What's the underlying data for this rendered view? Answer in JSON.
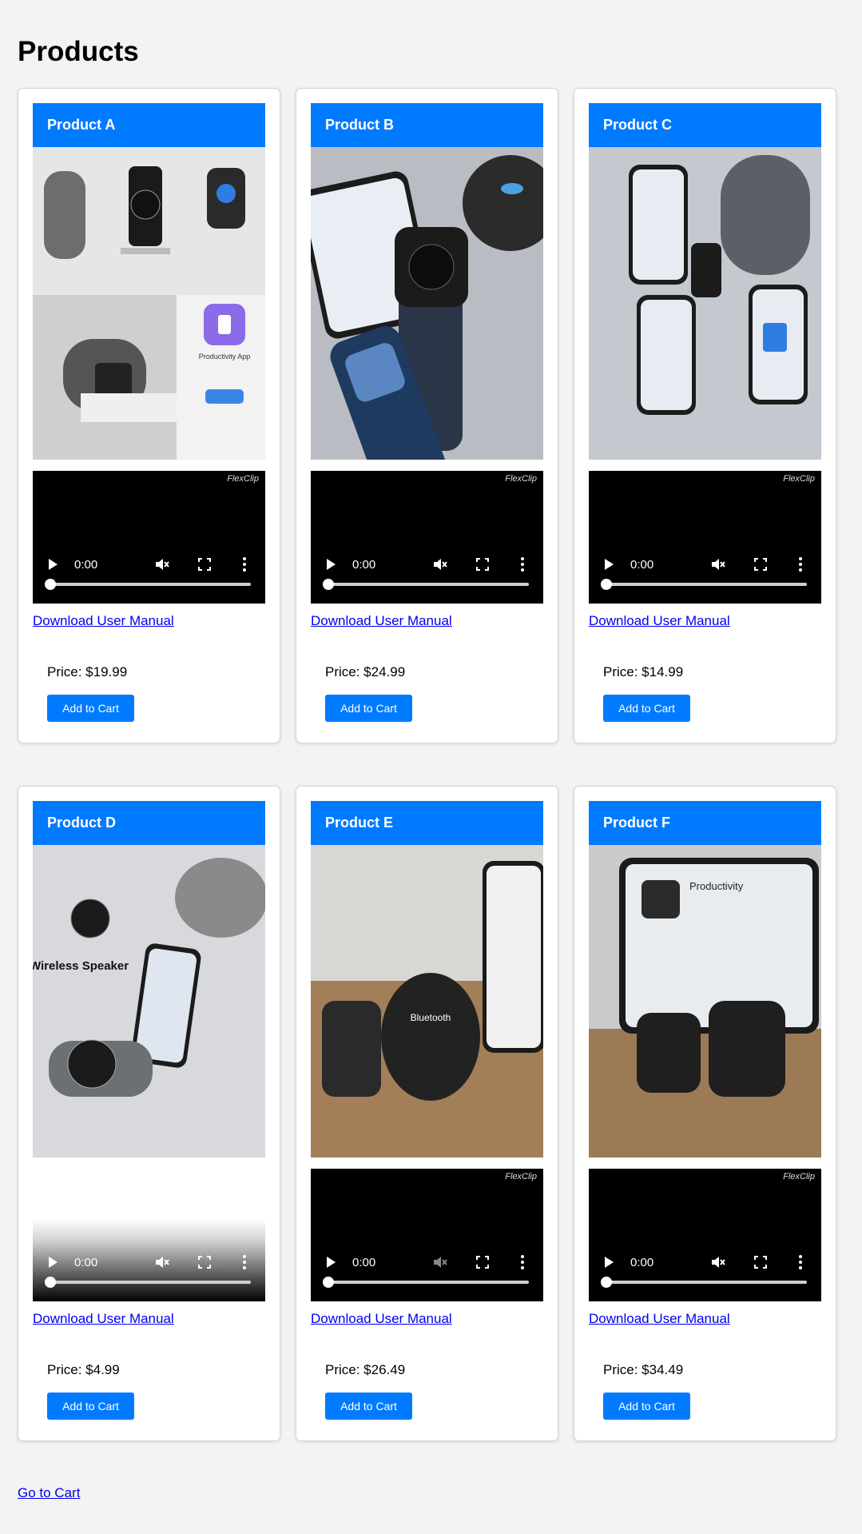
{
  "page": {
    "title": "Products",
    "go_to_cart": "Go to Cart"
  },
  "video": {
    "brand": "FlexClip",
    "time": "0:00"
  },
  "products": [
    {
      "name": "Product A",
      "manual": "Download User Manual",
      "price": "Price: $19.99",
      "button": "Add to Cart",
      "image_label": "Productivity App"
    },
    {
      "name": "Product B",
      "manual": "Download User Manual",
      "price": "Price: $24.99",
      "button": "Add to Cart",
      "image_label": ""
    },
    {
      "name": "Product C",
      "manual": "Download User Manual",
      "price": "Price: $14.99",
      "button": "Add to Cart",
      "image_label": ""
    },
    {
      "name": "Product D",
      "manual": "Download User Manual",
      "price": "Price: $4.99",
      "button": "Add to Cart",
      "image_label": "Wireless Speaker"
    },
    {
      "name": "Product E",
      "manual": "Download User Manual",
      "price": "Price: $26.49",
      "button": "Add to Cart",
      "image_label": "Bluetooth"
    },
    {
      "name": "Product F",
      "manual": "Download User Manual",
      "price": "Price: $34.49",
      "button": "Add to Cart",
      "image_label": "Productivity"
    }
  ],
  "colors": {
    "accent": "#007bff",
    "background": "#f3f3f3",
    "link": "#0000ee"
  },
  "icons": [
    "play-icon",
    "mute-icon",
    "fullscreen-icon",
    "more-options-icon"
  ]
}
